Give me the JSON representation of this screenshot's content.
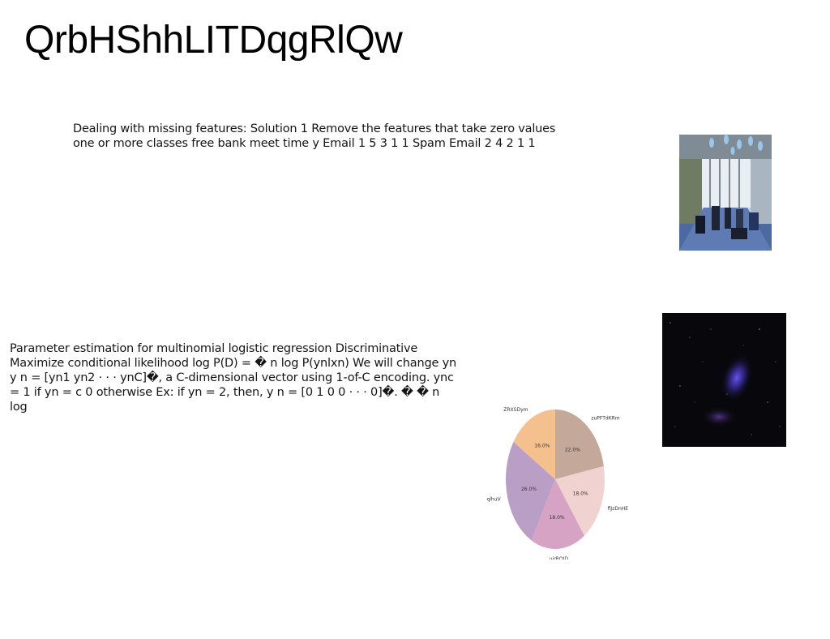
{
  "page": {
    "title": "QrbHShhLITDqgRlQw"
  },
  "paragraphs": [
    "Dealing with missing features: Solution 1 Remove the features that take zero values one or more classes free bank meet time y Email 1 5 3 1 1 Spam Email 2 4 2 1 1",
    "Parameter estimation for multinomial logistic regression Discriminative Maximize conditional likelihood log P(D) = � n log P(ynlxn) We will change yn y n = [yn1 yn2 · · · ynC]�, a C-dimensional vector using 1-of-C encoding. ync = 1 if yn = c 0 otherwise Ex: if yn = 2, then, y n = [0 1 0 0 · · · 0]�. � � n log"
  ],
  "images": {
    "office": "office-interior-photo",
    "space": "nebula-space-photo"
  },
  "chart_data": {
    "type": "pie",
    "categories": [
      "zuPFTdKRm",
      "flJzDnHE",
      "ujrROJD",
      "qlhuV",
      "ZRXSDym"
    ],
    "values": [
      22.0,
      18.0,
      18.0,
      26.0,
      16.0
    ],
    "labels": [
      "22.0%",
      "18.0%",
      "18.0%",
      "26.0%",
      "16.0%"
    ],
    "colors": [
      "#c4a99a",
      "#f0d3d0",
      "#d6a3c4",
      "#b99ec6",
      "#f4c08e"
    ],
    "start_angle": 90,
    "direction": "clockwise"
  }
}
